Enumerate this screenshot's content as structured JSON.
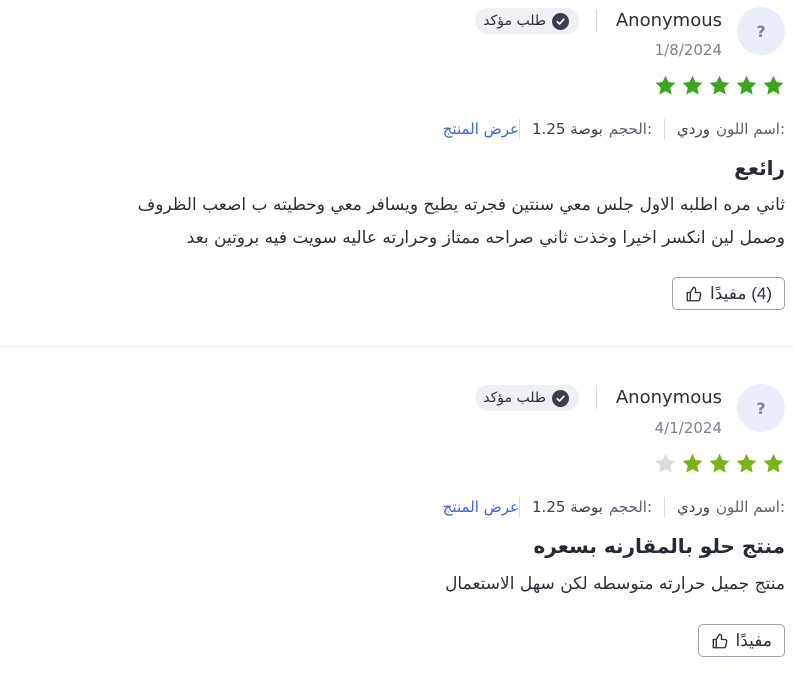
{
  "reviews": [
    {
      "avatar_glyph": "?",
      "author": "Anonymous",
      "date": "1/8/2024",
      "verified_label": "طلب مؤكد",
      "rating": 5,
      "max_rating": 5,
      "color_label": "اسم اللون:",
      "color_value": "وردي",
      "size_label": "الحجم:",
      "size_value": "1.25 بوصة",
      "view_product": "عرض المنتج",
      "title": "رائعع",
      "body_line1": "ثاني مره اطلبه الاول جلس معي سنتين فجرته يطيح ويسافر معي وحطيته ب اصعب الظروف",
      "body_line2": "وصمل لين انكسر اخيرا وخذت ثاني صراحه ممتاز وحرارته عاليه سويت فيه بروتين بعد",
      "helpful_label": "(4) مفيدًا"
    },
    {
      "avatar_glyph": "?",
      "author": "Anonymous",
      "date": "4/1/2024",
      "verified_label": "طلب مؤكد",
      "rating": 4,
      "max_rating": 5,
      "color_label": "اسم اللون:",
      "color_value": "وردي",
      "size_label": "الحجم:",
      "size_value": "1.25 بوصة",
      "view_product": "عرض المنتج",
      "title": "منتج حلو بالمقارنه بسعره",
      "body_line1": "منتج جميل حرارته متوسطه لكن سهل الاستعمال",
      "helpful_label": "مفيدًا"
    }
  ],
  "colors": {
    "star_full_5": "#3aa41c",
    "star_full_4": "#7ab317",
    "star_empty": "#d9dbe0",
    "link": "#3d63d8"
  },
  "icons": {
    "verified": "check-circle-icon",
    "helpful": "thumbs-up-icon",
    "star": "star-icon"
  }
}
